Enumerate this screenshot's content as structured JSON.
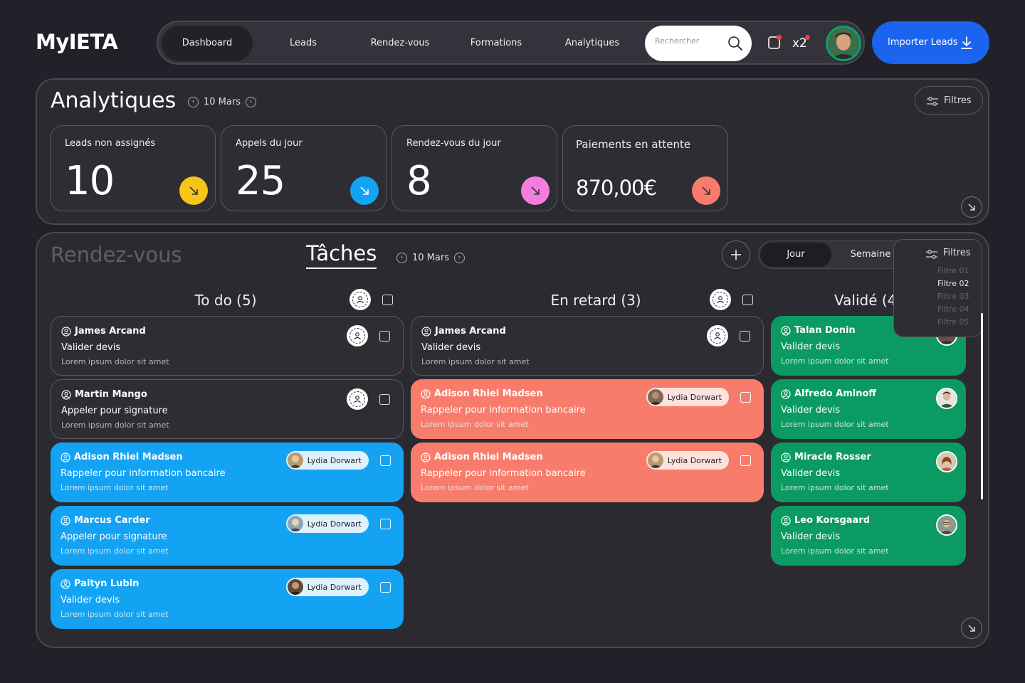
{
  "app": {
    "logo": "MyIETA"
  },
  "nav": {
    "items": [
      "Dashboard",
      "Leads",
      "Rendez-vous",
      "Formations",
      "Analytiques"
    ],
    "search_placeholder": "Rechercher",
    "notif_count": "x2",
    "import_label": "Importer Leads"
  },
  "analytics": {
    "title": "Analytiques",
    "date": "10 Mars",
    "filter_label": "Filtres",
    "cards": [
      {
        "label": "Leads non assignés",
        "value": "10",
        "color": "#f5c518"
      },
      {
        "label": "Appels du jour",
        "value": "25",
        "color": "#14a3f3"
      },
      {
        "label": "Rendez-vous du jour",
        "value": "8",
        "color": "#f47ee0"
      },
      {
        "label": "Paiements en attente",
        "value": "870,00€",
        "color": "#f87c6c"
      }
    ]
  },
  "tasks": {
    "tab_rdv": "Rendez-vous",
    "tab_taches": "Tâches",
    "date": "10 Mars",
    "segments": [
      "Jour",
      "Semaine"
    ],
    "filter_label": "Filtres",
    "filter_options": [
      "Filtre 01",
      "Filtre 02",
      "Filtre 03",
      "Filtre 04",
      "Filtre 05"
    ],
    "columns": [
      {
        "title": "To do (5)",
        "cards": [
          {
            "name": "James Arcand",
            "action": "Valider devis",
            "desc": "Lorem ipsum dolor sit amet",
            "color": "dark"
          },
          {
            "name": "Martin Mango",
            "action": "Appeler pour signature",
            "desc": "Lorem ipsum dolor sit amet",
            "color": "dark"
          },
          {
            "name": "Adison Rhiel Madsen",
            "action": "Rappeler pour information bancaire",
            "desc": "Lorem ipsum dolor sit amet",
            "assignee": "Lydia Dorwart",
            "color": "blue"
          },
          {
            "name": "Marcus Carder",
            "action": "Appeler pour signature",
            "desc": "Lorem ipsum dolor sit amet",
            "assignee": "Lydia Dorwart",
            "color": "blue"
          },
          {
            "name": "Paityn Lubin",
            "action": "Valider devis",
            "desc": "Lorem ipsum dolor sit amet",
            "assignee": "Lydia Dorwart",
            "color": "blue"
          }
        ]
      },
      {
        "title": "En retard (3)",
        "cards": [
          {
            "name": "James Arcand",
            "action": "Valider devis",
            "desc": "Lorem ipsum dolor sit amet",
            "color": "dark"
          },
          {
            "name": "Adison Rhiel Madsen",
            "action": "Rappeler pour information bancaire",
            "desc": "Lorem ipsum dolor sit amet",
            "assignee": "Lydia Dorwart",
            "color": "red"
          },
          {
            "name": "Adison Rhiel Madsen",
            "action": "Rappeler pour information bancaire",
            "desc": "Lorem ipsum dolor sit amet",
            "assignee": "Lydia Dorwart",
            "color": "red"
          }
        ]
      },
      {
        "title": "Validé (4",
        "cards": [
          {
            "name": "Talan Donin",
            "action": "Valider devis",
            "desc": "Lorem ipsum dolor sit amet",
            "color": "green"
          },
          {
            "name": "Alfredo Aminoff",
            "action": "Valider devis",
            "desc": "Lorem ipsum dolor sit amet",
            "color": "green"
          },
          {
            "name": "Miracle Rosser",
            "action": "Valider devis",
            "desc": "Lorem ipsum dolor sit amet",
            "color": "green"
          },
          {
            "name": "Leo Korsgaard",
            "action": "Valider devis",
            "desc": "Lorem ipsum dolor sit amet",
            "color": "green"
          }
        ]
      }
    ]
  }
}
